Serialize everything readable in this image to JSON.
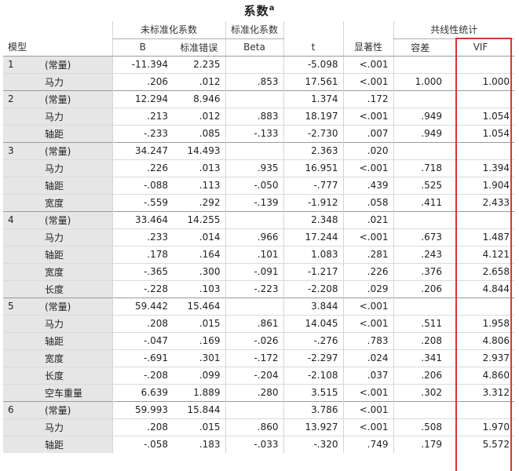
{
  "title": "系数",
  "title_sup": "a",
  "headers": {
    "model": "模型",
    "unstd": "未标准化系数",
    "std": "标准化系数",
    "colin": "共线性统计",
    "b": "B",
    "se": "标准错误",
    "beta": "Beta",
    "t": "t",
    "sig": "显著性",
    "tol": "容差",
    "vif": "VIF"
  },
  "colors": {
    "highlight": "#d4372f",
    "label_bg": "#e6e6e6"
  },
  "rows": [
    {
      "model": "1",
      "var": "(常量)",
      "b": "-11.394",
      "se": "2.235",
      "beta": "",
      "t": "-5.098",
      "sig": "<.001",
      "tol": "",
      "vif": ""
    },
    {
      "model": "",
      "var": "马力",
      "b": ".206",
      "se": ".012",
      "beta": ".853",
      "t": "17.561",
      "sig": "<.001",
      "tol": "1.000",
      "vif": "1.000"
    },
    {
      "model": "2",
      "var": "(常量)",
      "b": "12.294",
      "se": "8.946",
      "beta": "",
      "t": "1.374",
      "sig": ".172",
      "tol": "",
      "vif": ""
    },
    {
      "model": "",
      "var": "马力",
      "b": ".213",
      "se": ".012",
      "beta": ".883",
      "t": "18.197",
      "sig": "<.001",
      "tol": ".949",
      "vif": "1.054"
    },
    {
      "model": "",
      "var": "轴距",
      "b": "-.233",
      "se": ".085",
      "beta": "-.133",
      "t": "-2.730",
      "sig": ".007",
      "tol": ".949",
      "vif": "1.054"
    },
    {
      "model": "3",
      "var": "(常量)",
      "b": "34.247",
      "se": "14.493",
      "beta": "",
      "t": "2.363",
      "sig": ".020",
      "tol": "",
      "vif": ""
    },
    {
      "model": "",
      "var": "马力",
      "b": ".226",
      "se": ".013",
      "beta": ".935",
      "t": "16.951",
      "sig": "<.001",
      "tol": ".718",
      "vif": "1.394"
    },
    {
      "model": "",
      "var": "轴距",
      "b": "-.088",
      "se": ".113",
      "beta": "-.050",
      "t": "-.777",
      "sig": ".439",
      "tol": ".525",
      "vif": "1.904"
    },
    {
      "model": "",
      "var": "宽度",
      "b": "-.559",
      "se": ".292",
      "beta": "-.139",
      "t": "-1.912",
      "sig": ".058",
      "tol": ".411",
      "vif": "2.433"
    },
    {
      "model": "4",
      "var": "(常量)",
      "b": "33.464",
      "se": "14.255",
      "beta": "",
      "t": "2.348",
      "sig": ".021",
      "tol": "",
      "vif": ""
    },
    {
      "model": "",
      "var": "马力",
      "b": ".233",
      "se": ".014",
      "beta": ".966",
      "t": "17.244",
      "sig": "<.001",
      "tol": ".673",
      "vif": "1.487"
    },
    {
      "model": "",
      "var": "轴距",
      "b": ".178",
      "se": ".164",
      "beta": ".101",
      "t": "1.083",
      "sig": ".281",
      "tol": ".243",
      "vif": "4.121"
    },
    {
      "model": "",
      "var": "宽度",
      "b": "-.365",
      "se": ".300",
      "beta": "-.091",
      "t": "-1.217",
      "sig": ".226",
      "tol": ".376",
      "vif": "2.658"
    },
    {
      "model": "",
      "var": "长度",
      "b": "-.228",
      "se": ".103",
      "beta": "-.223",
      "t": "-2.208",
      "sig": ".029",
      "tol": ".206",
      "vif": "4.844"
    },
    {
      "model": "5",
      "var": "(常量)",
      "b": "59.442",
      "se": "15.464",
      "beta": "",
      "t": "3.844",
      "sig": "<.001",
      "tol": "",
      "vif": ""
    },
    {
      "model": "",
      "var": "马力",
      "b": ".208",
      "se": ".015",
      "beta": ".861",
      "t": "14.045",
      "sig": "<.001",
      "tol": ".511",
      "vif": "1.958"
    },
    {
      "model": "",
      "var": "轴距",
      "b": "-.047",
      "se": ".169",
      "beta": "-.026",
      "t": "-.276",
      "sig": ".783",
      "tol": ".208",
      "vif": "4.806"
    },
    {
      "model": "",
      "var": "宽度",
      "b": "-.691",
      "se": ".301",
      "beta": "-.172",
      "t": "-2.297",
      "sig": ".024",
      "tol": ".341",
      "vif": "2.937"
    },
    {
      "model": "",
      "var": "长度",
      "b": "-.208",
      "se": ".099",
      "beta": "-.204",
      "t": "-2.108",
      "sig": ".037",
      "tol": ".206",
      "vif": "4.860"
    },
    {
      "model": "",
      "var": "空车重量",
      "b": "6.639",
      "se": "1.889",
      "beta": ".280",
      "t": "3.515",
      "sig": "<.001",
      "tol": ".302",
      "vif": "3.312"
    },
    {
      "model": "6",
      "var": "(常量)",
      "b": "59.993",
      "se": "15.844",
      "beta": "",
      "t": "3.786",
      "sig": "<.001",
      "tol": "",
      "vif": ""
    },
    {
      "model": "",
      "var": "马力",
      "b": ".208",
      "se": ".015",
      "beta": ".860",
      "t": "13.927",
      "sig": "<.001",
      "tol": ".508",
      "vif": "1.970"
    },
    {
      "model": "",
      "var": "轴距",
      "b": "-.058",
      "se": ".183",
      "beta": "-.033",
      "t": "-.320",
      "sig": ".749",
      "tol": ".179",
      "vif": "5.572"
    }
  ]
}
